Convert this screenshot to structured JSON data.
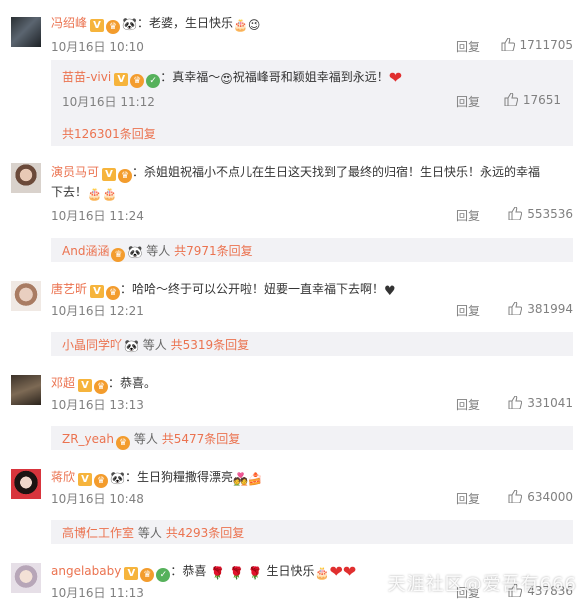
{
  "comments": [
    {
      "user": "冯绍峰",
      "text": "：老婆，生日快乐",
      "time": "10月16日 10:10",
      "reply_label": "回复",
      "likes": "1711705",
      "sub": {
        "user": "苗苗-vivi",
        "text": "：真幸福～",
        "text2": "祝福峰哥和颖姐幸福到永远！",
        "time": "10月16日 11:12",
        "reply_label": "回复",
        "likes": "17651"
      },
      "more": "共126301条回复"
    },
    {
      "user": "演员马可",
      "text": "：杀姐姐祝福小不点儿在生日这天找到了最终的归宿！生日快乐！永远的幸福下去！",
      "time": "10月16日 11:24",
      "reply_label": "回复",
      "likes": "553536",
      "more_user": "And涵涵",
      "more_mid": "等人",
      "more_count": "共7971条回复"
    },
    {
      "user": "唐艺昕",
      "text": "：哈哈～终于可以公开啦！妞要一直幸福下去啊！",
      "time": "10月16日 12:21",
      "reply_label": "回复",
      "likes": "381994",
      "more_user": "小晶同学吖",
      "more_mid": "等人",
      "more_count": "共5319条回复"
    },
    {
      "user": "邓超",
      "text": "：恭喜。",
      "time": "10月16日 13:13",
      "reply_label": "回复",
      "likes": "331041",
      "more_user": "ZR_yeah",
      "more_mid": "等人",
      "more_count": "共5477条回复"
    },
    {
      "user": "蒋欣",
      "text": "：生日狗糧撒得漂亮",
      "time": "10月16日 10:48",
      "reply_label": "回复",
      "likes": "634000",
      "more_user": "高博仁工作室",
      "more_mid": "等人",
      "more_count": "共4293条回复"
    },
    {
      "user": "angelababy",
      "text": "：恭喜",
      "text2": "生日快乐",
      "time": "10月16日 11:13",
      "reply_label": "回复",
      "likes": "437836"
    }
  ],
  "watermark": "天涯社区@爱吾有666",
  "icons": {
    "verified": "v-badge-icon",
    "crown": "crown-badge-icon",
    "panda": "panda-icon",
    "like": "thumb-up-icon"
  },
  "colors": {
    "username": "#eb7350",
    "meta": "#808080",
    "subbg": "#f2f2f5"
  }
}
